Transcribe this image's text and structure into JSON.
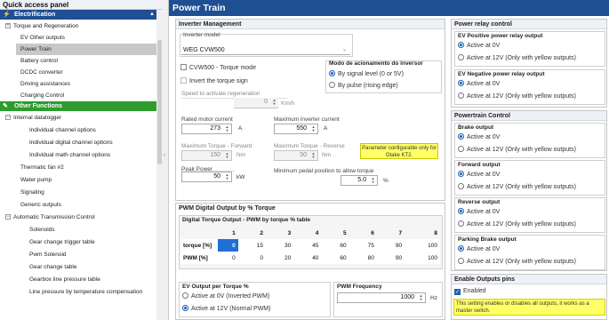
{
  "sidebar": {
    "title": "Quick access panel",
    "categories": [
      "Electrification",
      "Other Functions"
    ],
    "items": [
      "Torque and Regeneration",
      "EV Other outputs",
      "Power Train",
      "Battery control",
      "DCDC converter",
      "Driving assistances",
      "Charging Control",
      "Internal datalogger",
      "Individual channel options",
      "Individual digital channel options",
      "Individual math channel options",
      "Thermatic fan #2",
      "Water pump",
      "Signaling",
      "Generic outputs",
      "Automatic Transmission Control",
      "Solenoids",
      "Gear change trigger table",
      "Pwm Solenoid",
      "Gear change table",
      "Gearbox line pressure table",
      "Line pressure by temperature compensation"
    ]
  },
  "header": {
    "title": "Power Train"
  },
  "inverter": {
    "title": "Inverter Management",
    "model_label": "Inverter model",
    "model_value": "WEG CVW500",
    "torque_mode": "CVW500 - Torque mode",
    "invert_sign": "Invert the torque sign",
    "mode_title": "Modo de acionamento do inversor",
    "mode_signal": "By signal level (0 or 5V)",
    "mode_pulse": "By pulse (rising edge)",
    "speed_label": "Speed to activate regeneration",
    "speed_value": "0",
    "speed_unit": "Km/h",
    "rated_label": "Rated motor current",
    "rated_value": "273",
    "rated_unit": "A",
    "max_label": "Maximum inverter current",
    "max_value": "550",
    "max_unit": "A",
    "tfwd_label": "Maximum Torque - Forward",
    "tfwd_value": "150",
    "tfwd_unit": "Nm",
    "trev_label": "Maximum Torque - Reverse",
    "trev_value": "50",
    "trev_unit": "Nm",
    "note": "Parameter configurable only for Gtake KT2.",
    "peak_label": "Peak Power",
    "peak_value": "50",
    "peak_unit": "kW",
    "pedal_label": "Minimum pedal position to allow torque",
    "pedal_value": "5.0",
    "pedal_unit": "%"
  },
  "pwm": {
    "title": "PWM Digital Output by % Torque",
    "table_title": "Digital Torque Output - PWM by torque % table",
    "cols": [
      "1",
      "2",
      "3",
      "4",
      "5",
      "6",
      "7",
      "8"
    ],
    "row1_label": "torque [%]",
    "row1": [
      "0",
      "15",
      "30",
      "45",
      "60",
      "75",
      "90",
      "100"
    ],
    "row2_label": "PWM [%]",
    "row2": [
      "0",
      "0",
      "20",
      "40",
      "60",
      "80",
      "90",
      "100"
    ],
    "ev_title": "EV Output per Torque %",
    "ev_opt1": "Active at 0V (Inverted PWM)",
    "ev_opt2": "Active at 12V (Normal PWM)",
    "freq_title": "PWM Frequency",
    "freq_value": "1000",
    "freq_unit": "Hz"
  },
  "relay": {
    "title": "Power relay control",
    "pos_title": "EV Positive power relay output",
    "neg_title": "EV Negative power relay output",
    "opt0": "Active at 0V",
    "opt12": "Active at 12V (Only with yellow outputs)"
  },
  "ptc": {
    "title": "Powertrain Control",
    "brake": "Brake output",
    "forward": "Forward output",
    "reverse": "Reverse output",
    "parking": "Parking Brake output",
    "opt0": "Active at 0V",
    "opt12": "Active at 12V (Only with yellow outputs)"
  },
  "enable": {
    "title": "Enable Outputs pins",
    "label": "Enabled",
    "note": "This setting enables or disables all outputs, it works as a master switch."
  },
  "colors": {
    "header": "#1e4f93",
    "category": "#2d9c2d",
    "note": "#ffff66",
    "table_sel": "#1f6fd6"
  }
}
